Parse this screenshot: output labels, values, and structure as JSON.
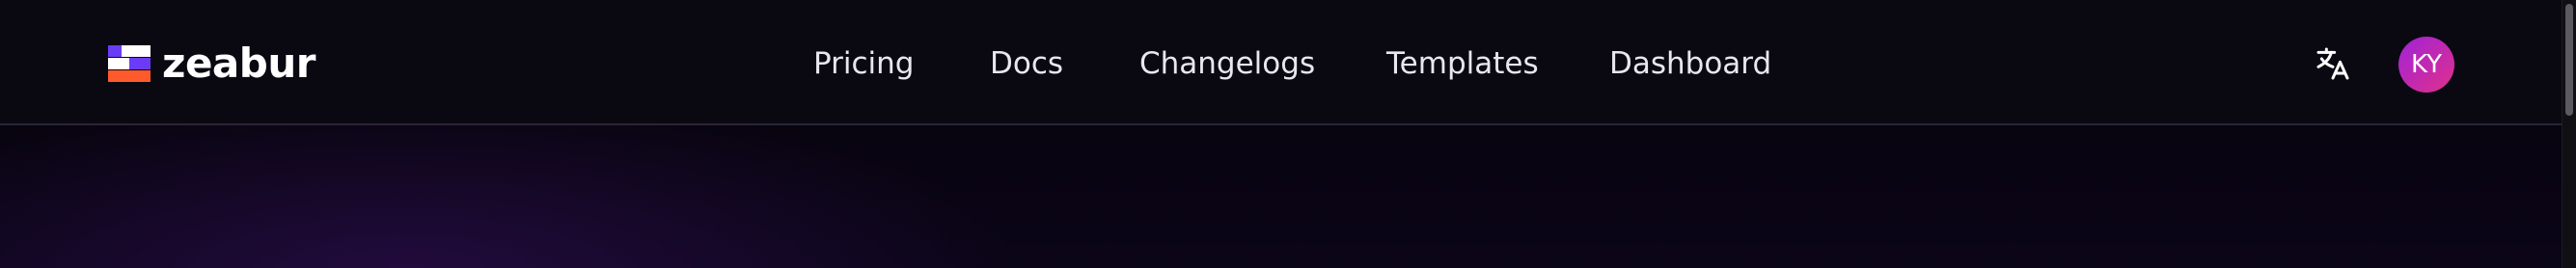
{
  "brand": {
    "name": "zeabur",
    "logo_colors": [
      "#6b3cf5",
      "#ffffff",
      "#ff5a2b"
    ]
  },
  "nav": {
    "items": [
      {
        "label": "Pricing"
      },
      {
        "label": "Docs"
      },
      {
        "label": "Changelogs"
      },
      {
        "label": "Templates"
      },
      {
        "label": "Dashboard"
      }
    ]
  },
  "actions": {
    "translate_icon": "translate-icon",
    "avatar_initials": "KY"
  },
  "colors": {
    "header_bg": "#0a0811",
    "accent_purple": "#a023d8",
    "accent_pink": "#e0308a"
  }
}
